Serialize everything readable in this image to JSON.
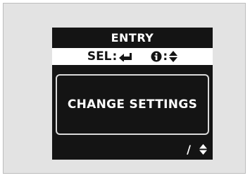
{
  "screen": {
    "title": "ENTRY",
    "hints": {
      "select_label": "SEL",
      "select_icon": "enter-arrow-icon",
      "info_icon": "info-icon",
      "info_action_icon": "up-down-arrows-icon"
    },
    "option_label": "CHANGE SETTINGS",
    "footer": {
      "separator": "/",
      "scroll_icon": "up-down-arrows-icon"
    }
  },
  "colors": {
    "frame_background": "#e3e3e3",
    "screen_background": "#141414",
    "hint_bar_background": "#ffffff",
    "text_light": "#ffffff"
  }
}
